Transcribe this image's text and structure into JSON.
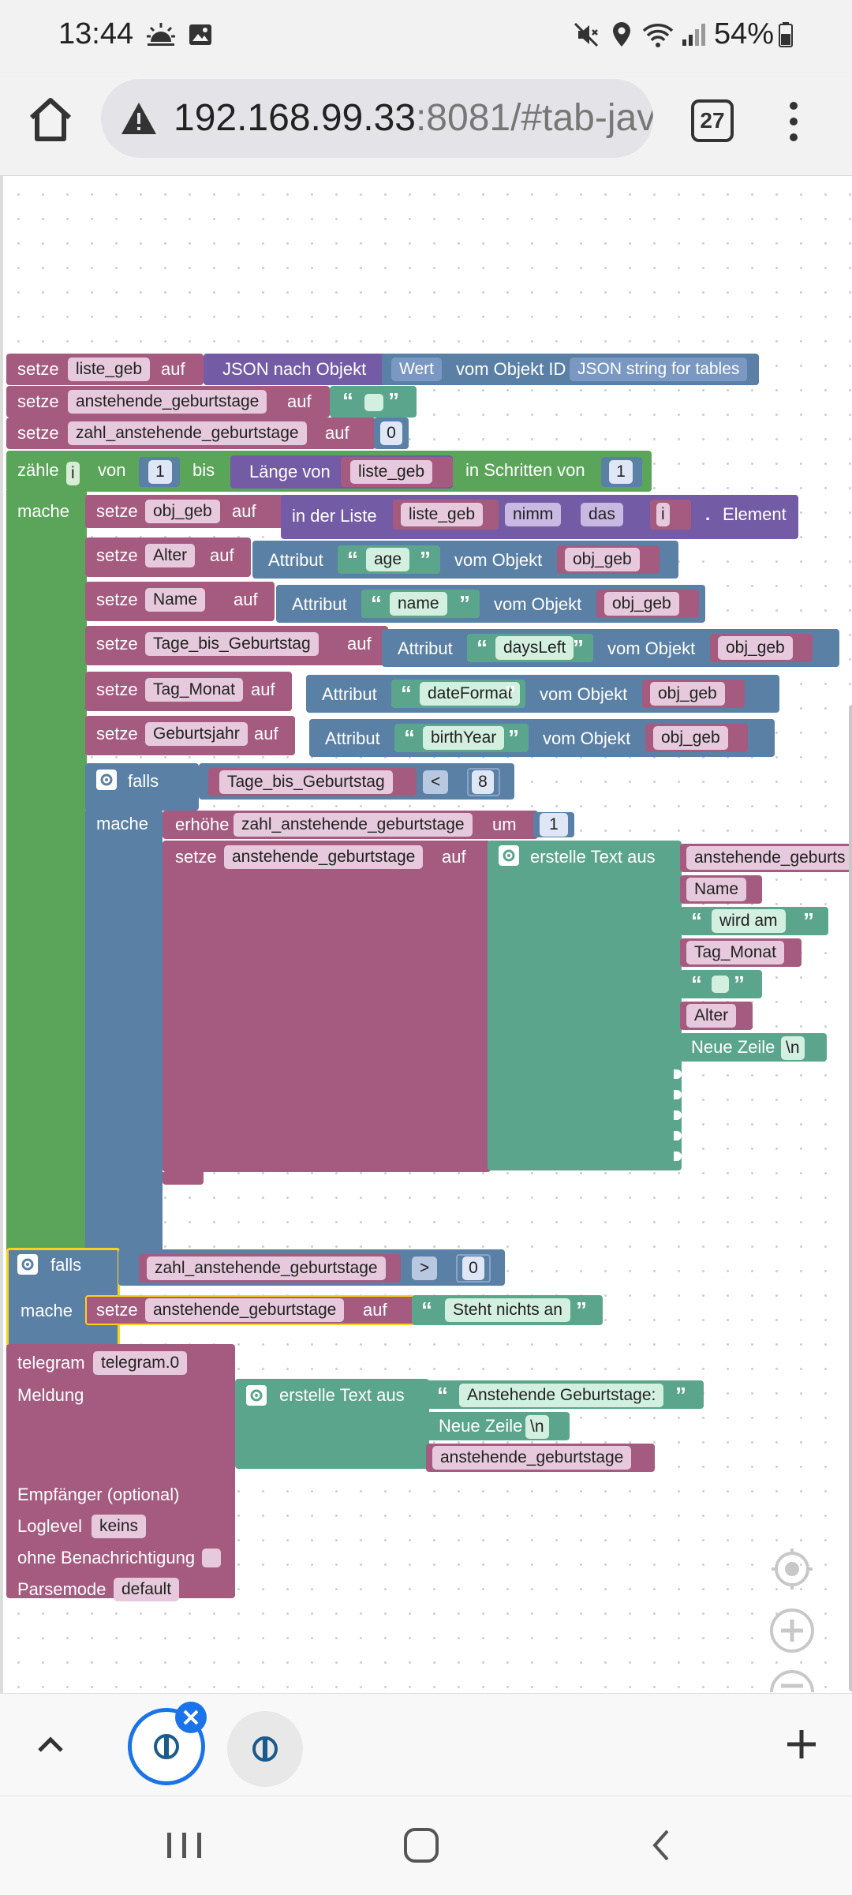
{
  "status_bar": {
    "time": "13:44",
    "battery": "54%",
    "icons": [
      "weather-sunrise-icon",
      "gallery-icon",
      "mute-icon",
      "location-icon",
      "wifi-icon",
      "signal-icon",
      "battery-icon"
    ]
  },
  "browser": {
    "url_host": "192.168.99.33",
    "url_rest": ":8081/#tab-jav",
    "tab_count": "27"
  },
  "blocks": {
    "kw_setze": "setze",
    "kw_auf": "auf",
    "kw_mache": "mache",
    "kw_falls": "falls",
    "kw_um": "um",
    "kw_erhoehe": "erhöhe",
    "kw_attribut": "Attribut",
    "kw_vom_objekt": "vom Objekt",
    "kw_erstelle_text_aus": "erstelle Text aus",
    "row1": {
      "var": "liste_geb",
      "fn": "JSON nach Objekt",
      "wert": "Wert",
      "vom_objekt_id": "vom Objekt ID",
      "obj_id": "JSON string for tables"
    },
    "row2": {
      "var": "anstehende_geburtstage"
    },
    "row3": {
      "var": "zahl_anstehende_geburtstage",
      "value": "0"
    },
    "loop": {
      "zaehle": "zähle",
      "var": "i",
      "von": "von",
      "from": "1",
      "bis": "bis",
      "laenge_von": "Länge von",
      "list": "liste_geb",
      "in_schritten_von": "in Schritten von",
      "step": "1"
    },
    "obj": {
      "var": "obj_geb",
      "in_der_liste": "in der Liste",
      "list": "liste_geb",
      "nimm": "nimm",
      "das": "das",
      "index": "i",
      "dot": ".",
      "element": "Element"
    },
    "attrs": [
      {
        "var": "Alter",
        "attr": "age",
        "obj": "obj_geb"
      },
      {
        "var": "Name",
        "attr": "name",
        "obj": "obj_geb"
      },
      {
        "var": "Tage_bis_Geburtstag",
        "attr": "daysLeft",
        "obj": "obj_geb"
      },
      {
        "var": "Tag_Monat",
        "attr": "dateFormat",
        "obj": "obj_geb"
      },
      {
        "var": "Geburtsjahr",
        "attr": "birthYear",
        "obj": "obj_geb"
      }
    ],
    "if1": {
      "var": "Tage_bis_Geburtstag",
      "op": "<",
      "value": "8"
    },
    "inc": {
      "var": "zahl_anstehende_geburtstage",
      "value": "1"
    },
    "text_set": {
      "var": "anstehende_geburtstage"
    },
    "text_items": {
      "item1": "anstehende_geburts",
      "item2": "Name",
      "item3": "wird am",
      "item4": "Tag_Monat",
      "item6": "Alter",
      "newline": "Neue Zeile",
      "newline_val": "\\n"
    },
    "if2": {
      "var": "zahl_anstehende_geburtstage",
      "op": ">",
      "value": "0",
      "set_var": "anstehende_geburtstage",
      "set_text": "Steht nichts an"
    },
    "telegram": {
      "label": "telegram",
      "instance": "telegram.0",
      "meldung": "Meldung",
      "text1": "Anstehende Geburtstage:",
      "newline": "Neue Zeile",
      "newline_val": "\\n",
      "var": "anstehende_geburtstage",
      "empfaenger": "Empfänger (optional)",
      "loglevel": "Loglevel",
      "loglevel_val": "keins",
      "ohne_benachrichtigung": "ohne Benachrichtigung",
      "parsemode": "Parsemode",
      "parsemode_val": "default"
    }
  },
  "colors": {
    "variables": "#a55b80",
    "loops": "#5ba55b",
    "logic": "#5b80a5",
    "text": "#5ba58c",
    "lists": "#745ba5",
    "selected": "#fbd11c"
  }
}
